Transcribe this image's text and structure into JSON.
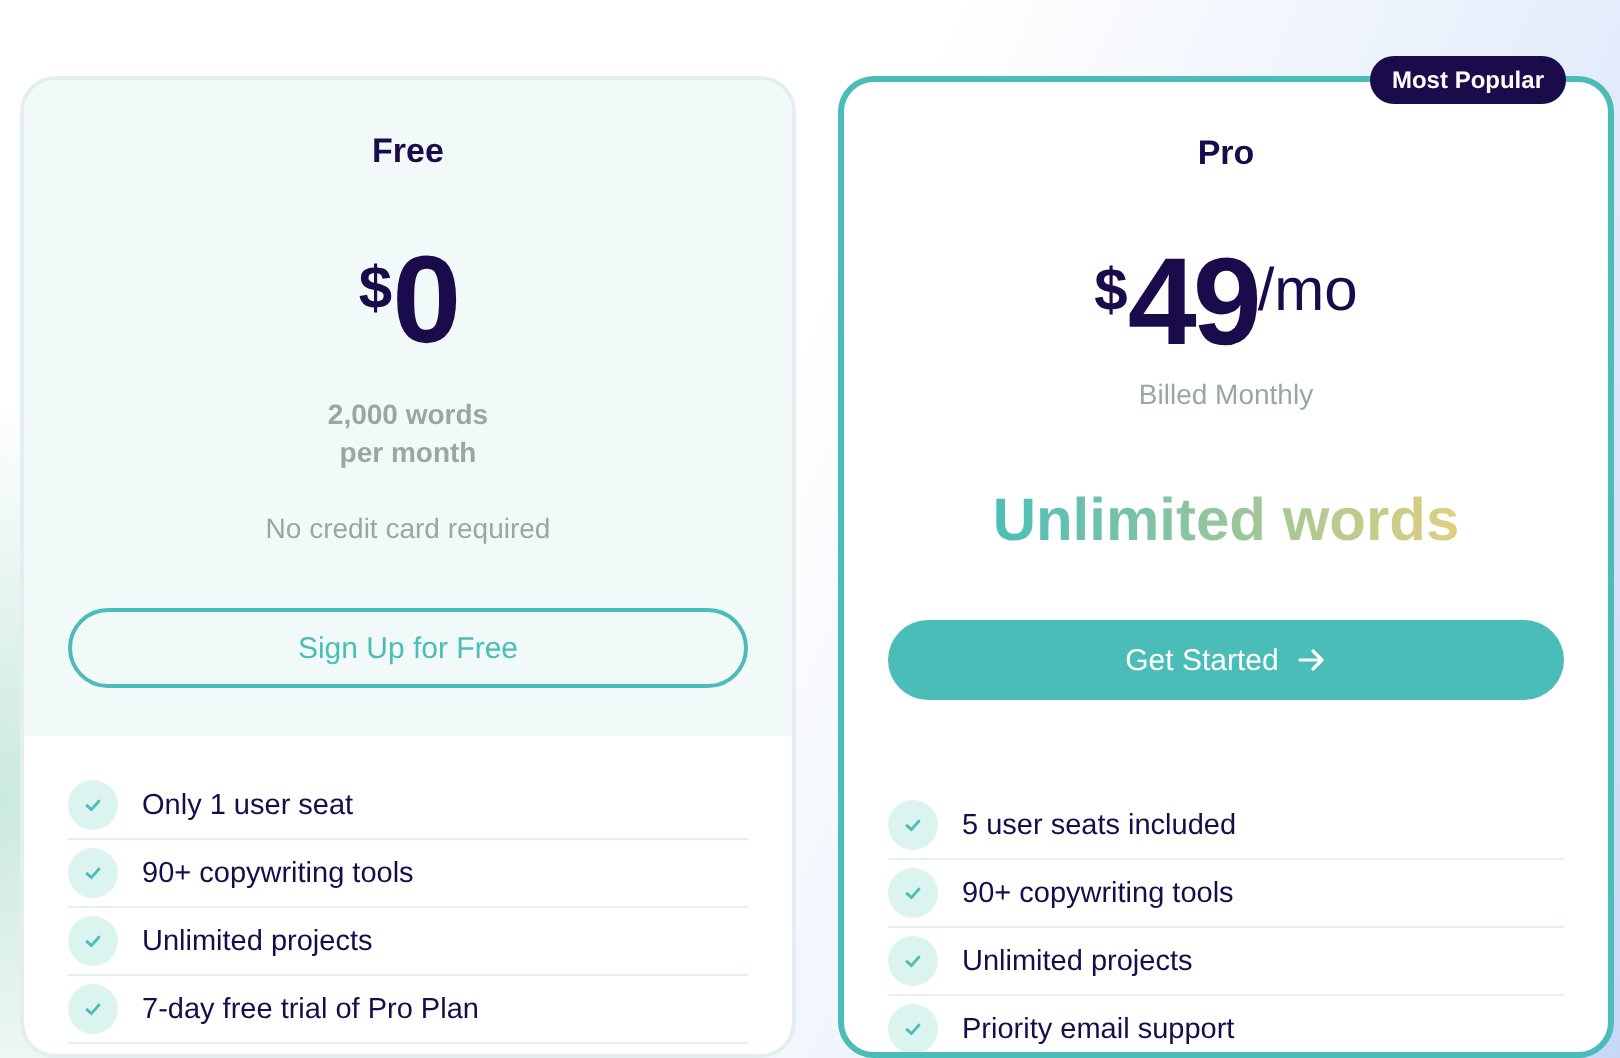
{
  "plans": [
    {
      "name": "Free",
      "featured": false,
      "currency": "$",
      "amount": "0",
      "words": "2,000 words per month",
      "note": "No credit card required",
      "button": {
        "label": "Sign Up for Free",
        "kind": "outline",
        "arrow": false
      },
      "features": [
        "Only 1 user seat",
        "90+ copywriting tools",
        "Unlimited projects",
        "7-day free trial of Pro Plan"
      ]
    },
    {
      "name": "Pro",
      "featured": true,
      "badge": "Most Popular",
      "currency": "$",
      "amount": "49",
      "period": "/mo",
      "billing": "Billed Monthly",
      "highlight": "Unlimited words",
      "button": {
        "label": "Get Started",
        "kind": "filled",
        "arrow": true
      },
      "features": [
        "5 user seats included",
        "90+ copywriting tools",
        "Unlimited projects",
        "Priority email support"
      ]
    }
  ]
}
